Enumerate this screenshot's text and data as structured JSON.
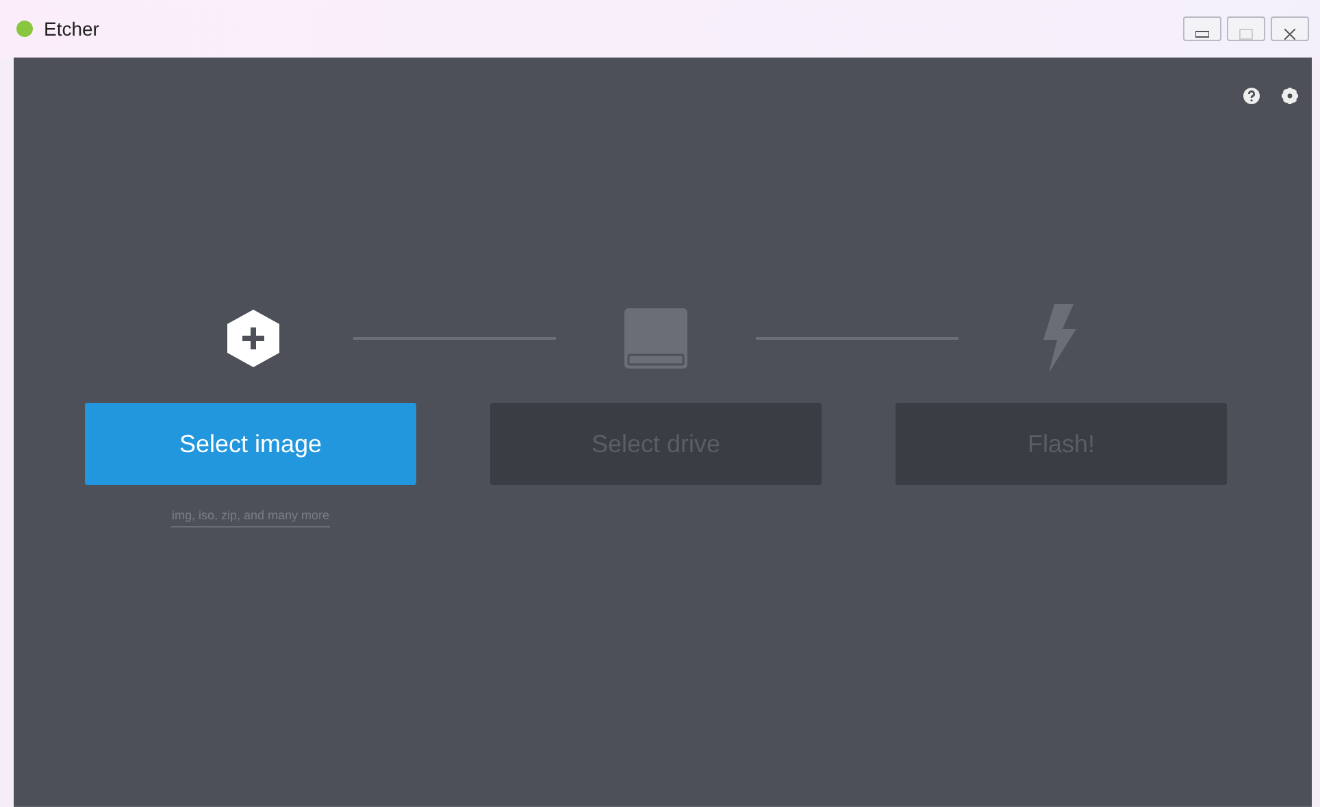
{
  "window": {
    "title": "Etcher"
  },
  "steps": [
    {
      "kind": "image",
      "disabled": false,
      "button": "Select image",
      "caption": "img, iso, zip, and many more"
    },
    {
      "kind": "drive",
      "disabled": true,
      "button": "Select drive"
    },
    {
      "kind": "flash",
      "disabled": true,
      "button": "Flash!"
    }
  ]
}
